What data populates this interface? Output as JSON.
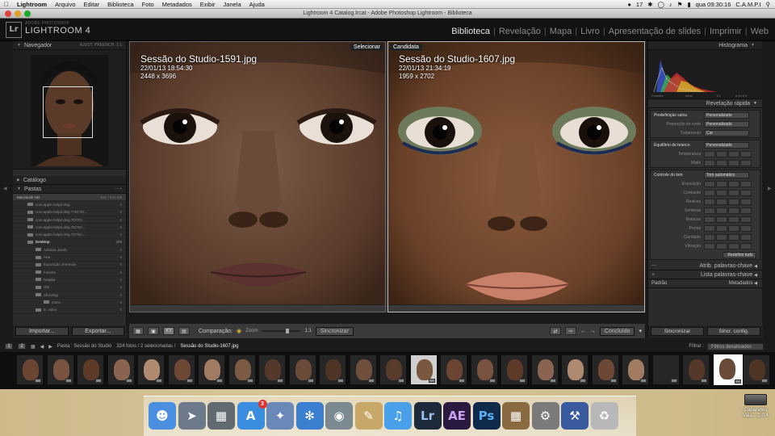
{
  "menubar": {
    "apple": "",
    "app_name": "Lightroom",
    "items": [
      "Arquivo",
      "Editar",
      "Biblioteca",
      "Foto",
      "Metadados",
      "Exibir",
      "Janela",
      "Ajuda"
    ],
    "status_number": "17",
    "clock": "qua 09:30:16",
    "user": "C.A.M.P.I"
  },
  "window_title": "Lightroom 4 Catalog.lrcat - Adobe Photoshop Lightroom - Biblioteca",
  "header": {
    "logo": "Lr",
    "brand_small": "ADOBE PHOTOSHOP",
    "brand_big": "LIGHTROOM 4",
    "modules": [
      "Biblioteca",
      "Revelação",
      "Mapa",
      "Livro",
      "Apresentação de slides",
      "Imprimir",
      "Web"
    ],
    "active_module": 0
  },
  "left_panel": {
    "navigator_title": "Navegador",
    "navigator_controls": "AJUST.  PREENCH.  1:1",
    "catalog_title": "Catálogo",
    "folders_title": "Pastas",
    "volume_name": "Macintosh HD",
    "volume_info": "931 / 931 GB",
    "folders": [
      {
        "name": "com.apple.helpd.dsig",
        "count": "0",
        "level": "sub"
      },
      {
        "name": "com.apple.helpd.dsig.??D/?D/...",
        "count": "0",
        "level": "sub"
      },
      {
        "name": "com.apple.helpd.dsig.?D/?D/...",
        "count": "0",
        "level": "sub"
      },
      {
        "name": "com.apple.helpd.dsig.?D/?D/...",
        "count": "0",
        "level": "sub"
      },
      {
        "name": "com.apple.helpd.dsig.?D/?D/...",
        "count": "0",
        "level": "sub"
      },
      {
        "name": "Desktop",
        "count": "100",
        "level": "top"
      },
      {
        "name": "Adriana Jacob",
        "count": "0",
        "level": "sub2"
      },
      {
        "name": "Ana",
        "count": "0",
        "level": "sub2"
      },
      {
        "name": "Exposição Jeremias",
        "count": "0",
        "level": "sub2"
      },
      {
        "name": "Fotinho",
        "count": "0",
        "level": "sub2"
      },
      {
        "name": "Natalia",
        "count": "0",
        "level": "sub2"
      },
      {
        "name": "Ole",
        "count": "0",
        "level": "sub2"
      },
      {
        "name": "Shooting",
        "count": "0",
        "level": "sub2"
      },
      {
        "name": "Ivano",
        "count": "0",
        "level": "sub3"
      },
      {
        "name": "E. video",
        "count": "0",
        "level": "sub2"
      }
    ],
    "import_label": "Importar...",
    "export_label": "Exportar..."
  },
  "compare": {
    "select": {
      "tag": "Selecionar",
      "filename": "Sessão do Studio-1591.jpg",
      "datetime": "22/01/13 18:54:30",
      "dimensions": "2448 x 3696"
    },
    "candidate": {
      "tag": "Candidata",
      "filename": "Sessão do Studio-1607.jpg",
      "datetime": "22/01/13 21:34:19",
      "dimensions": "1959 x 2702"
    }
  },
  "toolbar": {
    "compare_label": "Comparação:",
    "zoom_label": "Zoom",
    "zoom_value": "1:1",
    "sync_label": "Sincronizar",
    "done_label": "Concluído"
  },
  "right_panel": {
    "histogram_title": "Histograma",
    "histo_labels": [
      "Ponteiro",
      "Ideal",
      "1/1",
      "0,00 EV"
    ],
    "quick_develop_title": "Revelação rápida",
    "saved_preset_label": "Predefinição salva",
    "saved_preset_value": "Personalizado",
    "crop_label": "Proporção do corte",
    "crop_value": "Personalizado",
    "treatment_label": "Tratamento",
    "treatment_value": "Cor",
    "wb_label": "Equilíbrio de branco",
    "wb_value": "Personalizado",
    "temperature_label": "Temperatura",
    "tint_label": "Matiz",
    "tone_label": "Controle do tom",
    "auto_tone_label": "Tom automático",
    "tone_rows": [
      "Exposição",
      "Contraste",
      "Realces",
      "Sombras",
      "Brancos",
      "Pretos",
      "Claridade",
      "Vibração"
    ],
    "reset_label": "Redefinir tudo",
    "keywords_title": "Atrib. palavras-chave",
    "keyword_list_title": "Lista palavras-chave",
    "metadata_label": "Metadados",
    "metadata_preset": "Padrão",
    "sync_label": "Sincronizar",
    "sync_settings_label": "Sincr. config."
  },
  "filmstrip_bar": {
    "source": "Pasta : Sessão do Studio",
    "count": "324 fotos / 2 selecionadas /",
    "current": "Sessão do Studio-1607.jpg",
    "filter_label": "Filtrar :",
    "filter_value": "Filtros desativados"
  },
  "dock": {
    "icons": [
      "finder",
      "launchpad",
      "system-profiler",
      "app-store",
      "preview",
      "safari",
      "facetime",
      "notes",
      "itunes",
      "lightroom",
      "after-effects",
      "photoshop",
      "iphoto",
      "system-preferences",
      "xcode",
      "trash"
    ],
    "lr_label": "Lr",
    "ae_label": "AE",
    "ps_label": "Ps",
    "badge": "3"
  },
  "desktop_drive": {
    "name": "Capacetes Vala... 2.0.4"
  }
}
